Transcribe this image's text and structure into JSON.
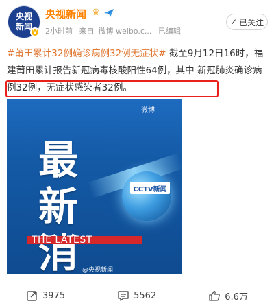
{
  "account": {
    "avatar_text": "央视新闻",
    "name": "央视新闻",
    "time": "2小时前",
    "source_prefix": "来自",
    "source": "微博 weibo.c...",
    "edited": "已编辑",
    "follow_label": "已关注",
    "verified_badge": "V"
  },
  "post": {
    "hashtag": "#莆田累计32例确诊病例32例无症状#",
    "text_main": "截至9月12日16时，福建莆田累计报告新冠病毒核酸阳性64例，其中",
    "text_highlighted": "新冠肺炎确诊病例32例，无症状感染者32例。"
  },
  "image": {
    "weibo_mark": "微博",
    "headline": "最新消息",
    "subtitle": "THE LATEST",
    "logo": "CCTV新闻",
    "watermark": "@央视新闻"
  },
  "actions": {
    "reposts": "3975",
    "comments": "5562",
    "likes": "6.6万"
  },
  "icons": [
    "crown-icon",
    "plane-icon",
    "repost-icon",
    "comment-icon",
    "like-icon"
  ],
  "colors": {
    "name": "#ff8200",
    "hashtag": "#e0762f",
    "highlight_border": "#e8211b",
    "image_blue": "#1e6bbf"
  }
}
